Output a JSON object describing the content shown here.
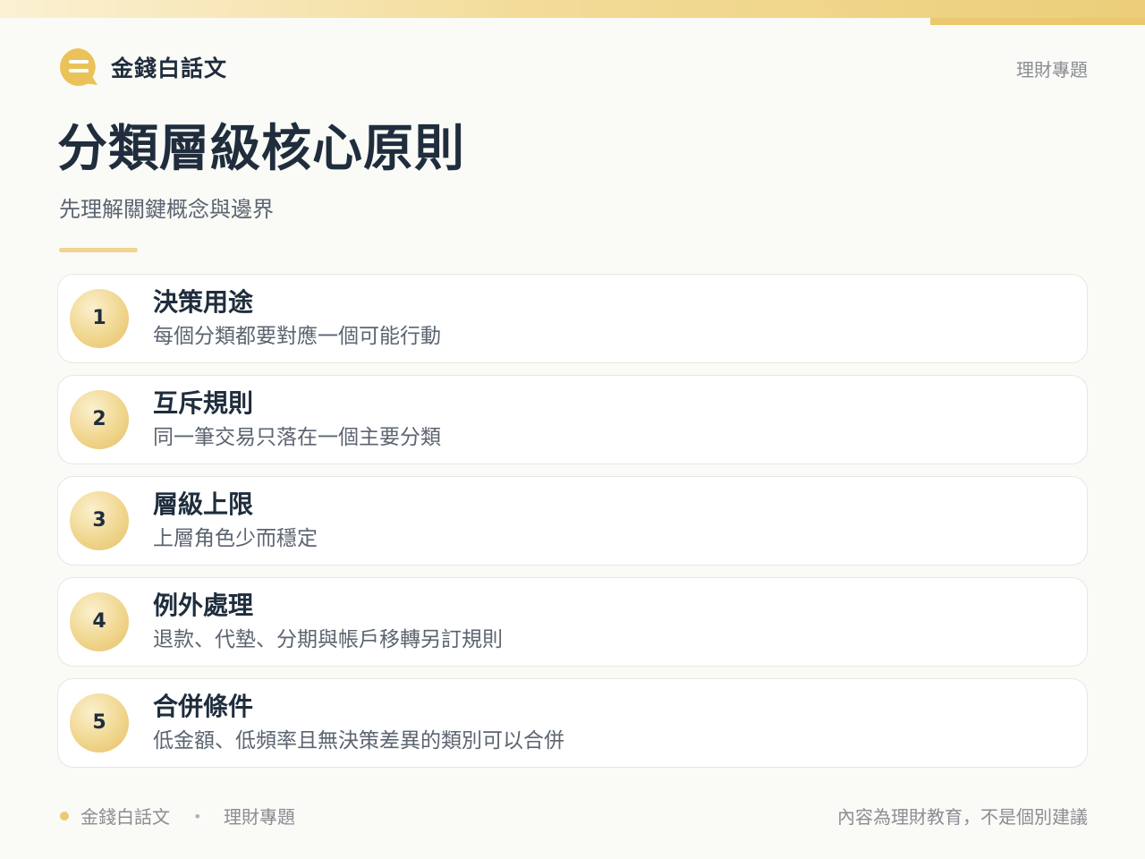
{
  "header": {
    "brand": "金錢白話文",
    "topic": "理財專題",
    "logo_icon": "chat-bubble-icon"
  },
  "title": "分類層級核心原則",
  "subtitle": "先理解關鍵概念與邊界",
  "principles": [
    {
      "number": "1",
      "title": "決策用途",
      "description": "每個分類都要對應一個可能行動"
    },
    {
      "number": "2",
      "title": "互斥規則",
      "description": "同一筆交易只落在一個主要分類"
    },
    {
      "number": "3",
      "title": "層級上限",
      "description": "上層角色少而穩定"
    },
    {
      "number": "4",
      "title": "例外處理",
      "description": "退款、代墊、分期與帳戶移轉另訂規則"
    },
    {
      "number": "5",
      "title": "合併條件",
      "description": "低金額、低頻率且無決策差異的類別可以合併"
    }
  ],
  "footer": {
    "brand": "金錢白話文",
    "separator": "•",
    "topic": "理財專題",
    "disclaimer": "內容為理財教育，不是個別建議"
  },
  "colors": {
    "accent": "#ebcb72",
    "text_primary": "#1f2d3d",
    "text_secondary": "#5b6470",
    "text_muted": "#8a8d92"
  }
}
